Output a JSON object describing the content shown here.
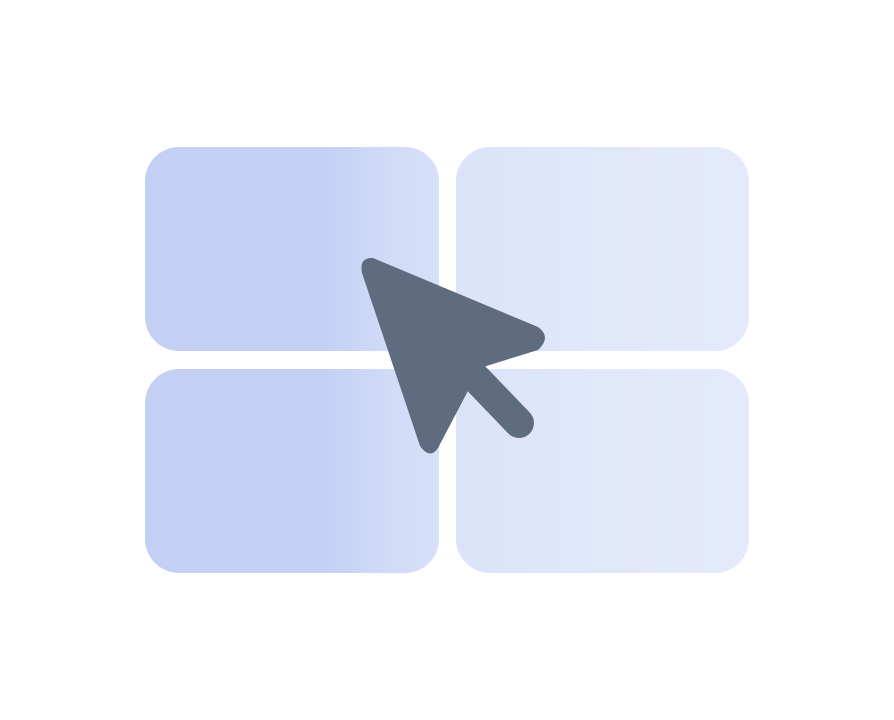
{
  "icon": {
    "name": "select-window-icon",
    "tiles": [
      "tile-top-left",
      "tile-top-right",
      "tile-bottom-left",
      "tile-bottom-right"
    ],
    "cursor": "arrow-cursor-icon"
  },
  "colors": {
    "background": "#ffffff",
    "tile_left": "#c3d0f4",
    "tile_right": "#e1e8fa",
    "cursor": "#5f6b7e"
  }
}
